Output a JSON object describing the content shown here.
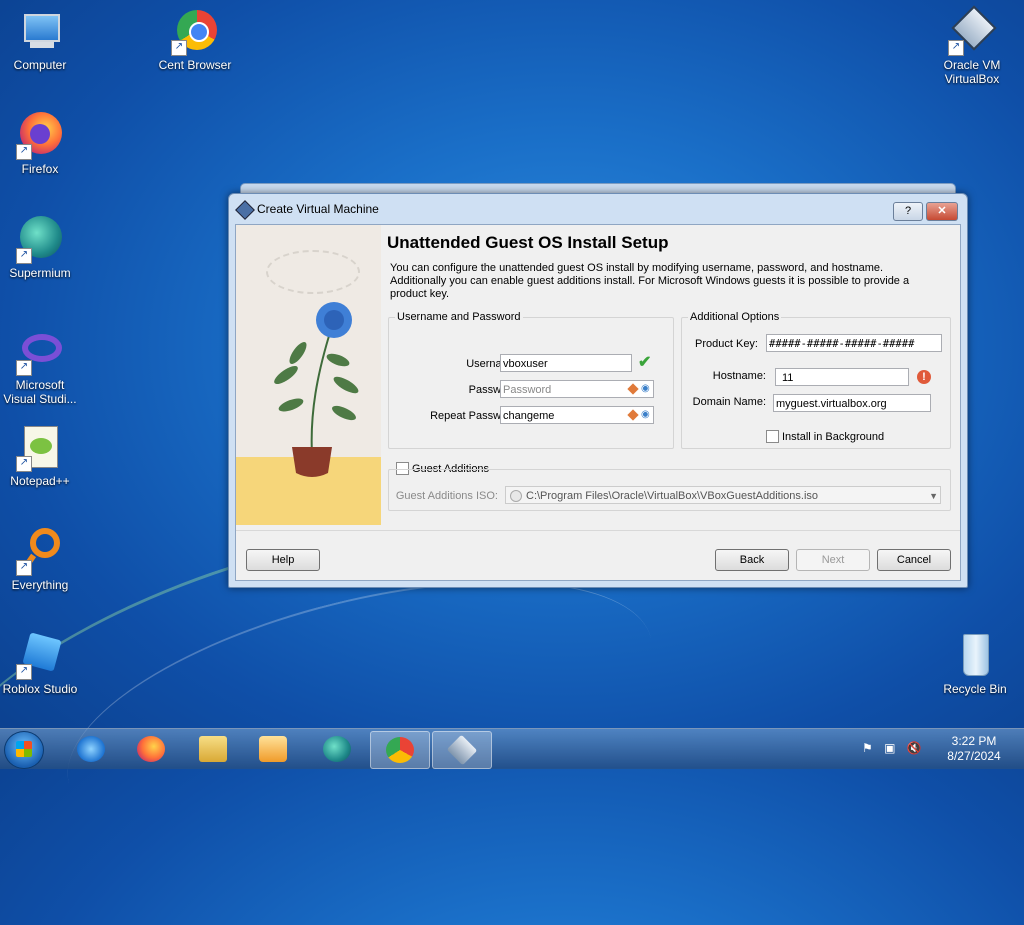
{
  "desktop": {
    "icons": [
      {
        "label": "Computer"
      },
      {
        "label": "Cent Browser"
      },
      {
        "label": "Oracle VM VirtualBox"
      },
      {
        "label": "Firefox"
      },
      {
        "label": "Supermium"
      },
      {
        "label": "Microsoft Visual Studi..."
      },
      {
        "label": "Notepad++"
      },
      {
        "label": "Everything"
      },
      {
        "label": "Roblox Studio"
      },
      {
        "label": "Recycle Bin"
      }
    ]
  },
  "dialog": {
    "title": "Create Virtual Machine",
    "help_title_btn": "?",
    "close_title_btn": "✕",
    "heading": "Unattended Guest OS Install Setup",
    "description": "You can configure the unattended guest OS install by modifying username, password, and hostname. Additionally you can enable guest additions install. For Microsoft Windows guests it is possible to provide a product key.",
    "user_group": {
      "title": "Username and Password",
      "username_label": "Username:",
      "username_value": "vboxuser",
      "password_label": "Password:",
      "password_placeholder": "Password",
      "repeat_label": "Repeat Password:",
      "repeat_value": "changeme"
    },
    "options_group": {
      "title": "Additional Options",
      "product_key_label": "Product Key:",
      "product_key_value": "#####-#####-#####-#####",
      "hostname_label": "Hostname:",
      "hostname_value": "11",
      "domain_label": "Domain Name:",
      "domain_value": "myguest.virtualbox.org",
      "install_bg_label": "Install in Background"
    },
    "guest_additions": {
      "label": "Guest Additions",
      "iso_label": "Guest Additions ISO:",
      "iso_value": "C:\\Program Files\\Oracle\\VirtualBox\\VBoxGuestAdditions.iso"
    },
    "buttons": {
      "help": "Help",
      "back": "Back",
      "next": "Next",
      "cancel": "Cancel"
    }
  },
  "taskbar": {
    "clock_time": "3:22 PM",
    "clock_date": "8/27/2024"
  }
}
